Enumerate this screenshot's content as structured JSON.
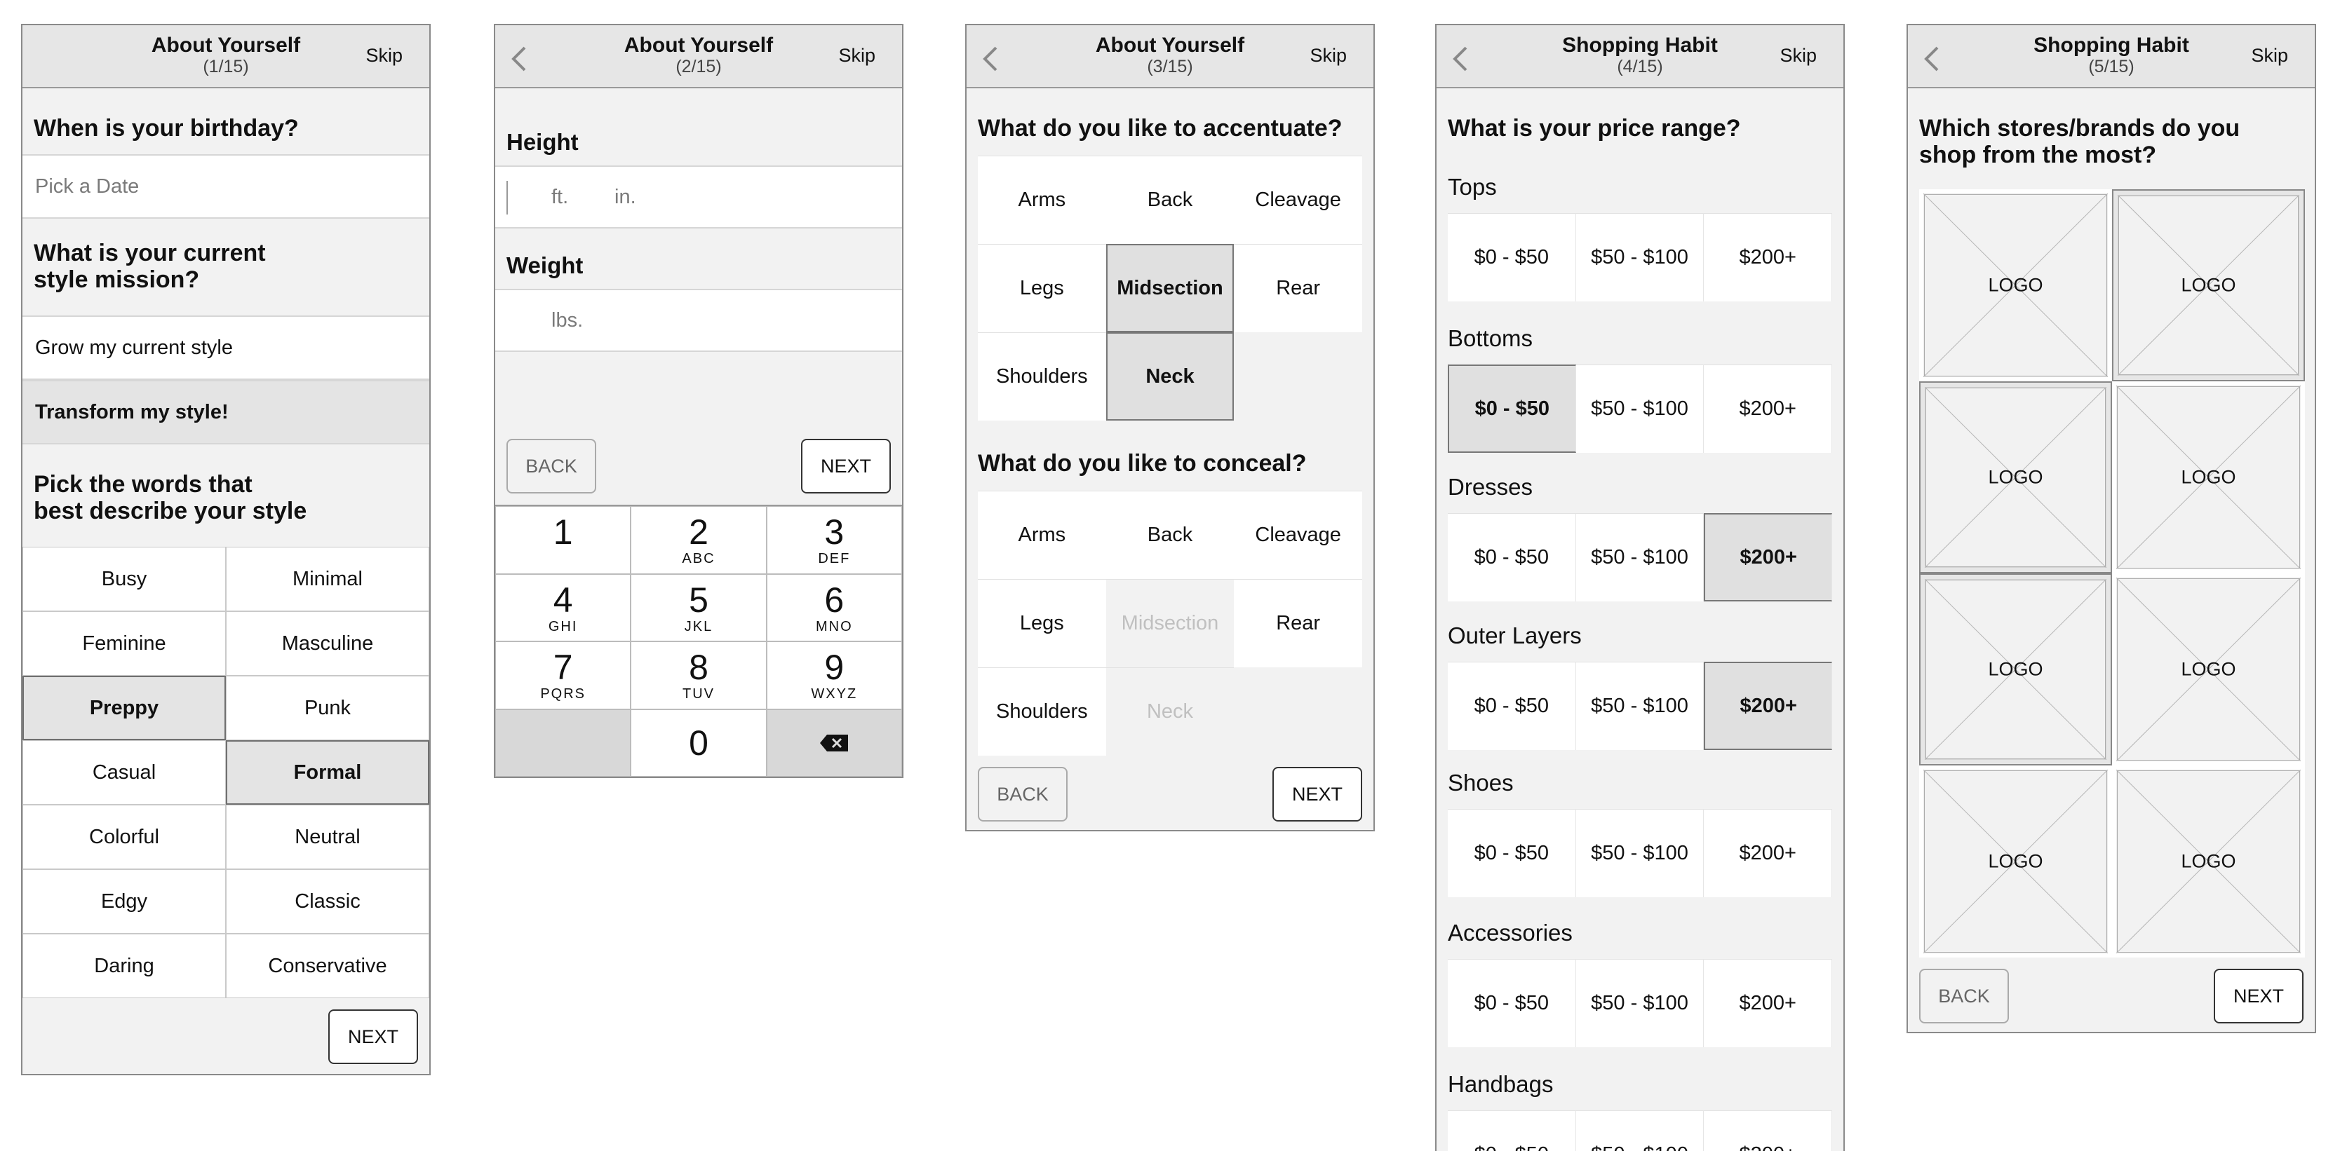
{
  "common": {
    "skip": "Skip",
    "back": "BACK",
    "next": "NEXT",
    "logo": "LOGO"
  },
  "s1": {
    "title": "About Yourself",
    "step": "(1/15)",
    "q_birthday": "When is your birthday?",
    "date_placeholder": "Pick a Date",
    "q_mission_1": "What is your current",
    "q_mission_2": "style mission?",
    "mission_options": [
      "Grow my current style",
      "Transform my style!"
    ],
    "mission_selected": "Transform my style!",
    "q_words_1": "Pick the words that",
    "q_words_2": "best describe your style",
    "words": [
      "Busy",
      "Minimal",
      "Feminine",
      "Masculine",
      "Preppy",
      "Punk",
      "Casual",
      "Formal",
      "Colorful",
      "Neutral",
      "Edgy",
      "Classic",
      "Daring",
      "Conservative"
    ],
    "words_selected": [
      "Preppy",
      "Formal"
    ]
  },
  "s2": {
    "title": "About Yourself",
    "step": "(2/15)",
    "height_label": "Height",
    "ft": "ft.",
    "in": "in.",
    "weight_label": "Weight",
    "lbs": "lbs.",
    "keys": [
      {
        "d": "1",
        "l": ""
      },
      {
        "d": "2",
        "l": "ABC"
      },
      {
        "d": "3",
        "l": "DEF"
      },
      {
        "d": "4",
        "l": "GHI"
      },
      {
        "d": "5",
        "l": "JKL"
      },
      {
        "d": "6",
        "l": "MNO"
      },
      {
        "d": "7",
        "l": "PQRS"
      },
      {
        "d": "8",
        "l": "TUV"
      },
      {
        "d": "9",
        "l": "WXYZ"
      },
      {
        "d": "0",
        "l": ""
      }
    ]
  },
  "s3": {
    "title": "About Yourself",
    "step": "(3/15)",
    "q_accentuate": "What do you like to accentuate?",
    "accentuate": [
      "Arms",
      "Back",
      "Cleavage",
      "Legs",
      "Midsection",
      "Rear",
      "Shoulders",
      "Neck"
    ],
    "accentuate_selected": [
      "Midsection",
      "Neck"
    ],
    "q_conceal": "What do you like to conceal?",
    "conceal": [
      "Arms",
      "Back",
      "Cleavage",
      "Legs",
      "Midsection",
      "Rear",
      "Shoulders",
      "Neck"
    ],
    "conceal_disabled": [
      "Midsection",
      "Neck"
    ]
  },
  "s4": {
    "title": "Shopping Habit",
    "step": "(4/15)",
    "q_price": "What is your price range?",
    "ranges": [
      "$0 - $50",
      "$50 - $100",
      "$200+"
    ],
    "categories": [
      {
        "name": "Tops",
        "selected": -1
      },
      {
        "name": "Bottoms",
        "selected": 0
      },
      {
        "name": "Dresses",
        "selected": 2
      },
      {
        "name": "Outer Layers",
        "selected": 2
      },
      {
        "name": "Shoes",
        "selected": -1
      },
      {
        "name": "Accessories",
        "selected": -1
      },
      {
        "name": "Handbags",
        "selected": -1
      }
    ]
  },
  "s5": {
    "title": "Shopping Habit",
    "step": "(5/15)",
    "q_stores_1": "Which stores/brands do you",
    "q_stores_2": "shop from the most?",
    "logo_selected": [
      false,
      true,
      true,
      false,
      true,
      false,
      false,
      false
    ]
  }
}
